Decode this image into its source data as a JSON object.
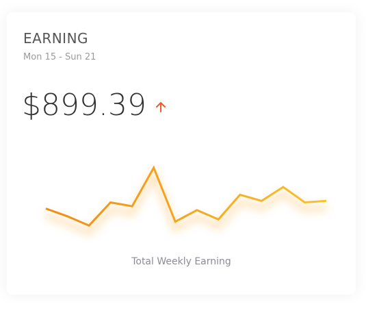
{
  "card": {
    "title": "EARNING",
    "date_range": "Mon 15 - Sun 21",
    "amount": "$899.39",
    "trend_icon": "arrow-up-icon",
    "caption": "Total Weekly Earning"
  },
  "colors": {
    "line_start": "#f28c13",
    "line_end": "#f8c12f",
    "trend_arrow": "#f05a28"
  },
  "chart_data": {
    "type": "line",
    "title": "",
    "xlabel": "",
    "ylabel": "",
    "x": [
      1,
      2,
      3,
      4,
      5,
      6,
      7,
      8,
      9,
      10,
      11,
      12,
      13,
      14
    ],
    "values": [
      52,
      42,
      30,
      60,
      55,
      105,
      35,
      50,
      38,
      70,
      62,
      80,
      60,
      62
    ],
    "ylim": [
      0,
      120
    ],
    "grid": false,
    "legend": "none",
    "axes_visible": false
  }
}
